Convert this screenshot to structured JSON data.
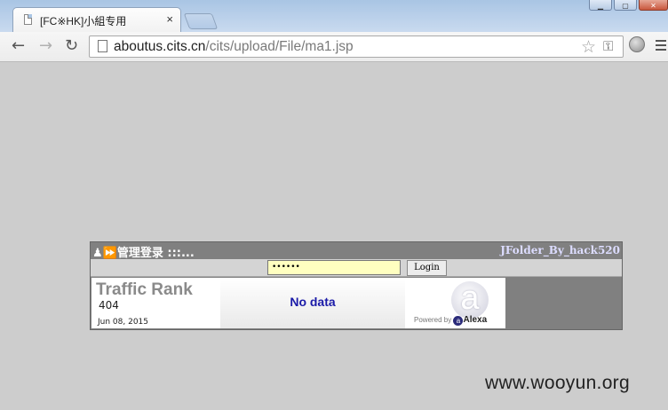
{
  "browser": {
    "tab": {
      "title": "[FC※HK]小組专用",
      "close": "×"
    },
    "nav": {
      "back": "←",
      "forward": "→",
      "reload": "↻"
    },
    "address": {
      "host": "aboutus.cits.cn",
      "path": "/cits/upload/File/ma1.jsp"
    },
    "icons": [
      "page-icon",
      "star-icon",
      "key-icon",
      "globe-icon",
      "menu-icon"
    ]
  },
  "panel": {
    "header_left": "♟⏩管理登录 :::...",
    "header_right": "JFolder_By_hack520",
    "password_value": "••••••",
    "login_label": "Login"
  },
  "alexa": {
    "title": "Traffic Rank",
    "rank": "404",
    "date": "Jun 08, 2015",
    "nodata": "No data",
    "logo_letter": "a",
    "powered_by": "Powered by",
    "brand": "Alexa"
  },
  "watermark": "www.wooyun.org",
  "colors": {
    "page_bg": "#cdcdcd",
    "panel_bg": "#808080",
    "password_bg": "#ffffc0",
    "nodata_text": "#1a1aa8"
  }
}
